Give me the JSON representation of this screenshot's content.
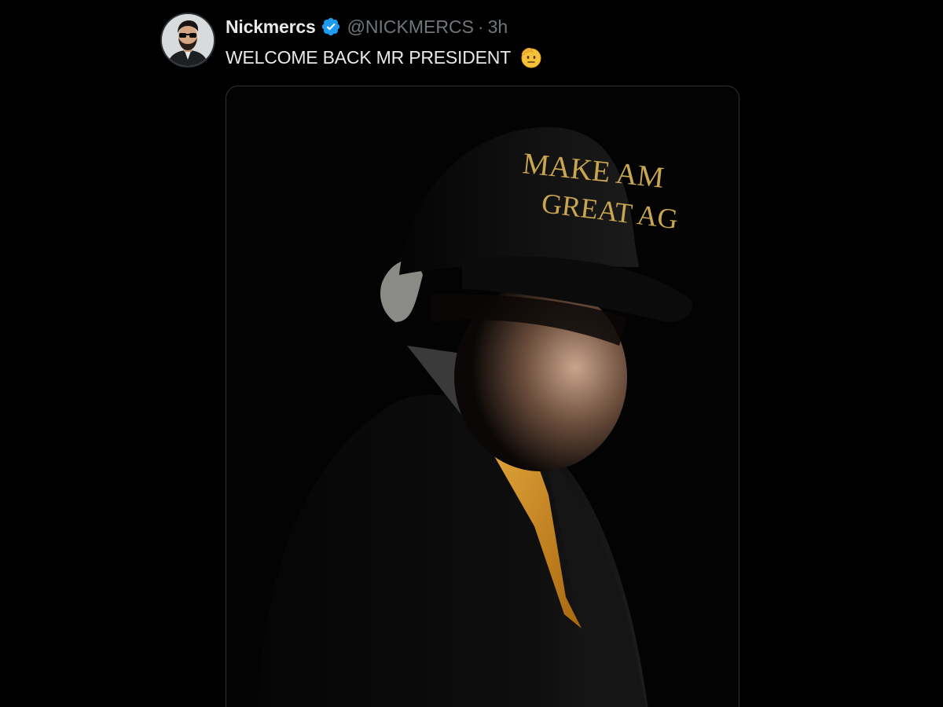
{
  "tweet": {
    "display_name": "Nickmercs",
    "handle": "@NICKMERCS",
    "separator": "·",
    "time": "3h",
    "text": "WELCOME BACK MR PRESIDENT",
    "emoji": "saluting-face-emoji",
    "verified_icon": "verified-badge-icon",
    "verified_color": "#1d9bf0",
    "media": {
      "hat_text_line1": "MAKE AM",
      "hat_text_line2": "GREAT AG",
      "tie_color": "#c8861a",
      "hat_text_color": "#c9a650"
    }
  }
}
